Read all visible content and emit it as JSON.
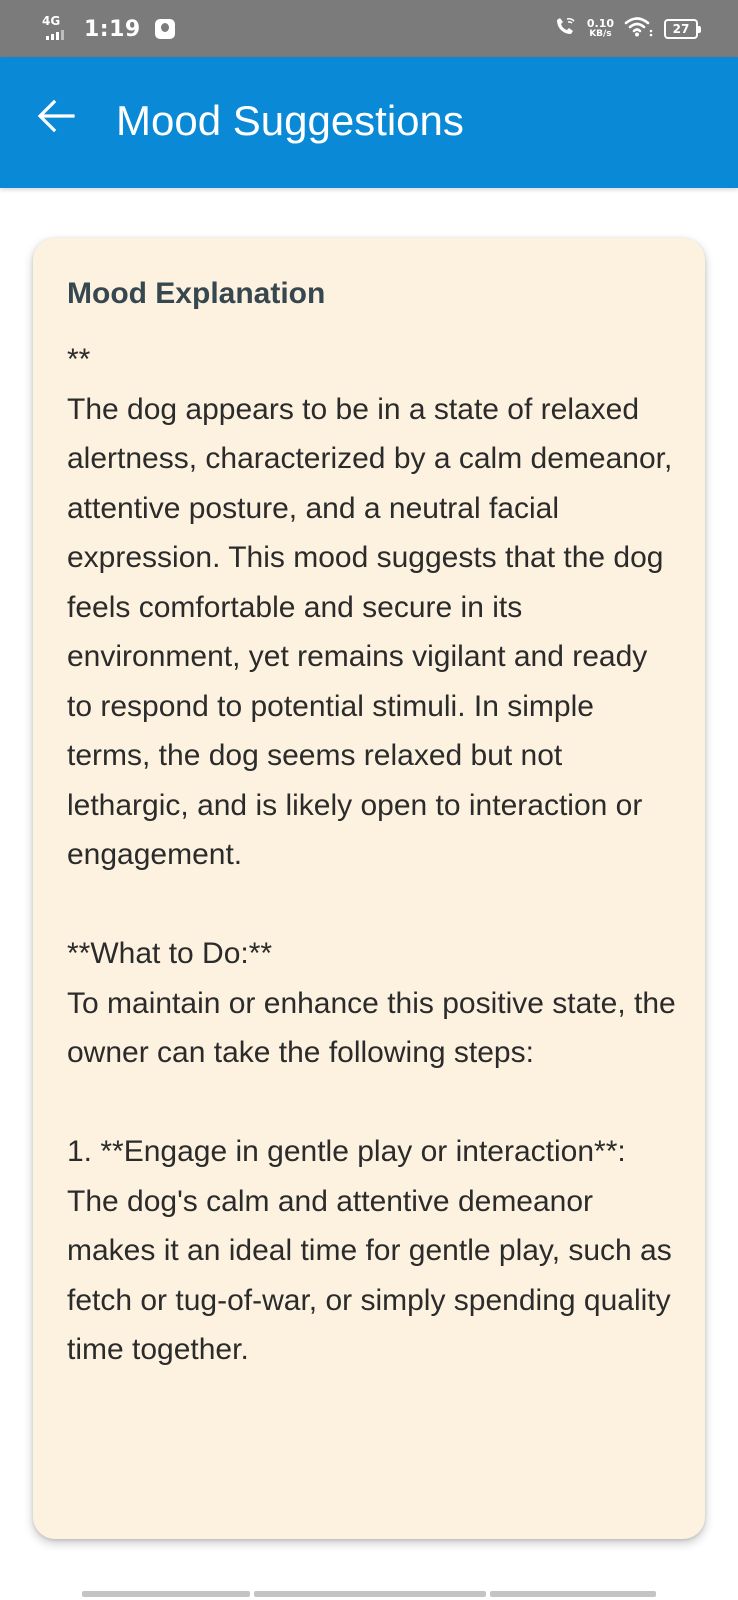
{
  "status_bar": {
    "network_type": "4G",
    "time": "1:19",
    "speed_value": "0.10",
    "speed_unit": "KB/s",
    "battery_level": "27",
    "icons": [
      "signal-bars-icon",
      "app-notification-icon",
      "wifi-calling-icon",
      "wifi-icon",
      "battery-icon"
    ]
  },
  "app_bar": {
    "title": "Mood Suggestions",
    "back_icon": "arrow-back-icon",
    "background_color": "#0a8ad6"
  },
  "card": {
    "title": "Mood Explanation",
    "background_color": "#fdf2e0",
    "body": "**\nThe dog appears to be in a state of relaxed alertness, characterized by a calm demeanor, attentive posture, and a neutral facial expression. This mood suggests that the dog feels comfortable and secure in its environment, yet remains vigilant and ready to respond to potential stimuli. In simple terms, the dog seems relaxed but not lethargic, and is likely open to interaction or engagement.\n\n**What to Do:**\nTo maintain or enhance this positive state, the owner can take the following steps:\n\n1. **Engage in gentle play or interaction**: The dog's calm and attentive demeanor makes it an ideal time for gentle play, such as fetch or tug-of-war, or simply spending quality time together."
  }
}
